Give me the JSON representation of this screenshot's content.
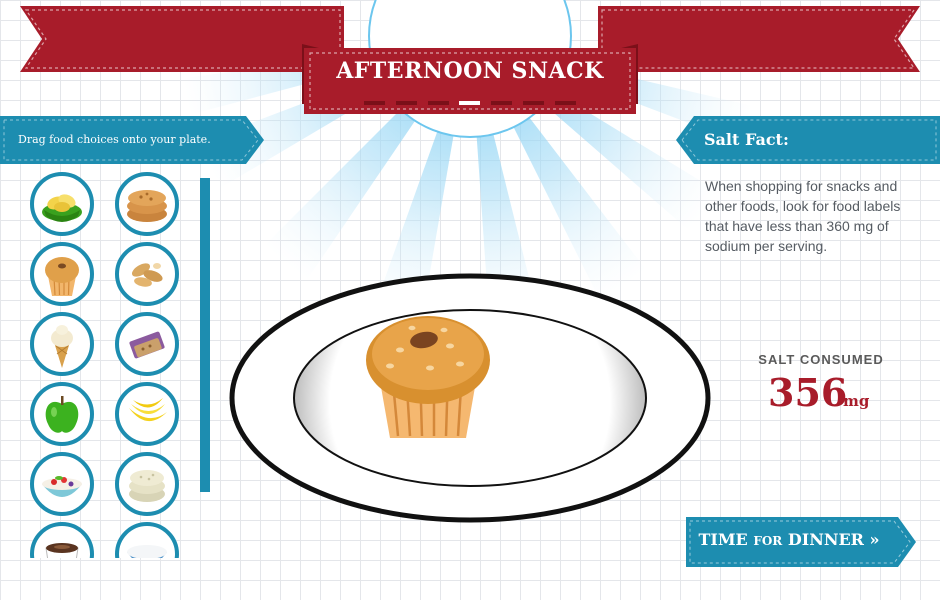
{
  "header": {
    "title": "AFTERNOON SNACK",
    "pager": {
      "total": 7,
      "active_index": 3
    },
    "colors": {
      "ribbon": "#a81c2a",
      "ribbon_dark": "#7b1019",
      "ray": "#7fd0f5"
    }
  },
  "instructions": {
    "text": "Drag food choices onto your plate.",
    "color": "#1d8db0"
  },
  "salt_fact": {
    "heading": "Salt Fact:",
    "body": "When shopping for snacks and other foods, look for food labels that have less than 360 mg of sodium per serving."
  },
  "food_choices": [
    {
      "name": "chips-icon"
    },
    {
      "name": "cookies-icon"
    },
    {
      "name": "muffin-icon"
    },
    {
      "name": "peanuts-icon"
    },
    {
      "name": "ice-cream-cone-icon"
    },
    {
      "name": "granola-bar-icon"
    },
    {
      "name": "green-apple-icon"
    },
    {
      "name": "bananas-icon"
    },
    {
      "name": "fruit-yogurt-bowl-icon"
    },
    {
      "name": "rice-cakes-icon"
    },
    {
      "name": "hot-cocoa-icon"
    },
    {
      "name": "milk-bowl-icon"
    }
  ],
  "plate": {
    "items": [
      {
        "name": "muffin-icon"
      }
    ]
  },
  "salt_consumed": {
    "label": "SALT CONSUMED",
    "value": "356",
    "unit": "mg",
    "color": "#a81c2a"
  },
  "next_button": {
    "label_before": "TIME",
    "label_small": "FOR",
    "label_after": "DINNER »"
  }
}
